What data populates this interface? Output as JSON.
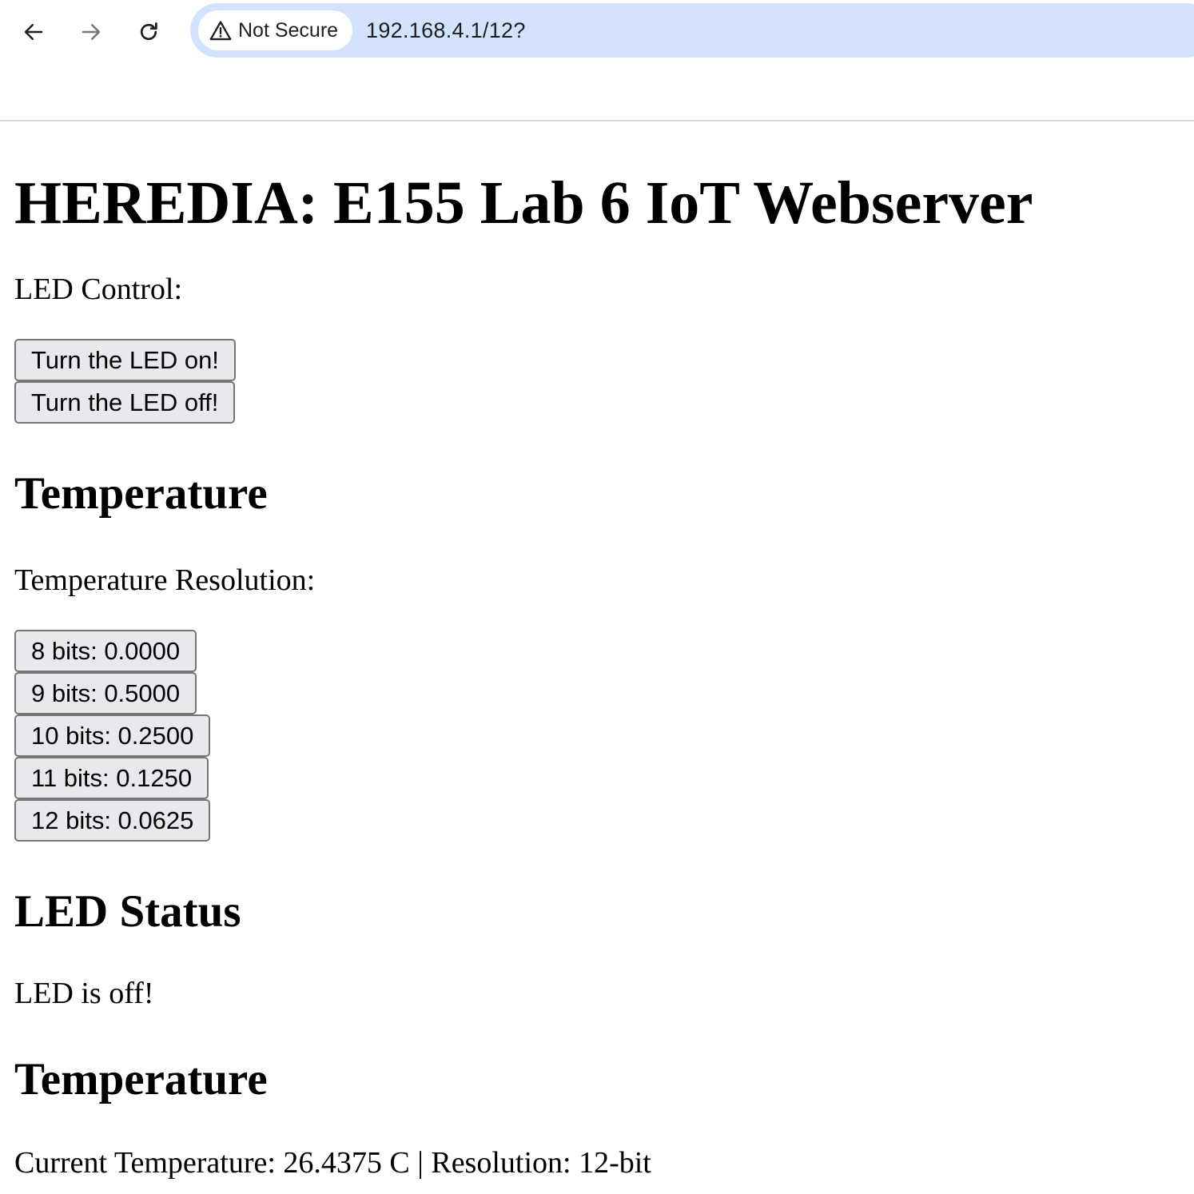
{
  "browser": {
    "security_label": "Not Secure",
    "url": "192.168.4.1/12?"
  },
  "page": {
    "title": "HEREDIA: E155 Lab 6 IoT Webserver",
    "led_control_label": "LED Control:",
    "led_buttons": [
      "Turn the LED on!",
      "Turn the LED off!"
    ],
    "temperature_heading": "Temperature",
    "resolution_label": "Temperature Resolution:",
    "resolution_buttons": [
      "8 bits: 0.0000",
      "9 bits: 0.5000",
      "10 bits: 0.2500",
      "11 bits: 0.1250",
      "12 bits: 0.0625"
    ],
    "led_status_heading": "LED Status",
    "led_status_text": "LED is off!",
    "temperature_heading_2": "Temperature",
    "current_temperature": "Current Temperature: 26.4375 C | Resolution: 12-bit"
  }
}
